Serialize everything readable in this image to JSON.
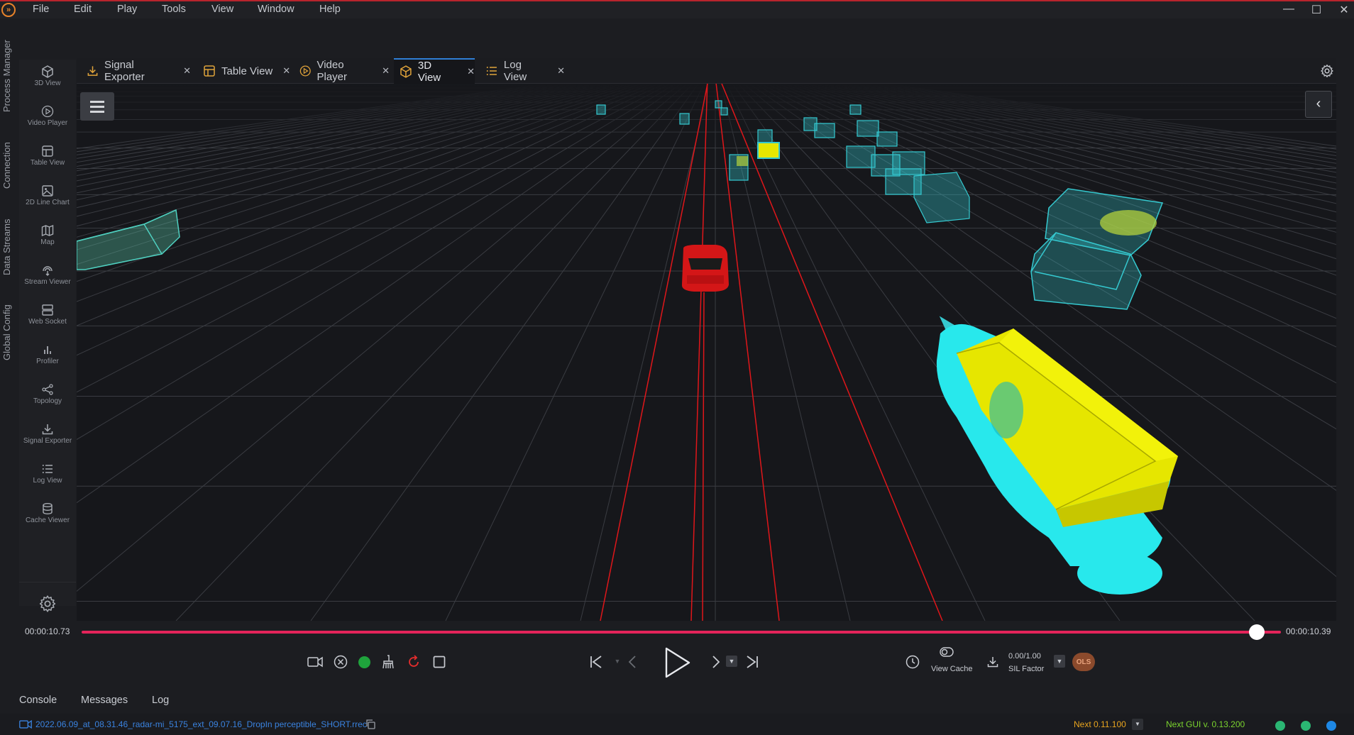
{
  "menu": [
    "File",
    "Edit",
    "Play",
    "Tools",
    "View",
    "Window",
    "Help"
  ],
  "side_tabs": [
    "Process Manager",
    "Connection",
    "Data Streams",
    "Global Config"
  ],
  "nav": [
    {
      "label": "3D View",
      "icon": "cube-icon"
    },
    {
      "label": "Video Player",
      "icon": "play-circle-icon"
    },
    {
      "label": "Table View",
      "icon": "table-icon"
    },
    {
      "label": "2D Line Chart",
      "icon": "image-icon"
    },
    {
      "label": "Map",
      "icon": "map-icon"
    },
    {
      "label": "Stream Viewer",
      "icon": "stream-icon"
    },
    {
      "label": "Web Socket",
      "icon": "server-icon"
    },
    {
      "label": "Profiler",
      "icon": "bar-chart-icon"
    },
    {
      "label": "Topology",
      "icon": "share-icon"
    },
    {
      "label": "Signal Exporter",
      "icon": "download-icon"
    },
    {
      "label": "Log View",
      "icon": "list-icon"
    },
    {
      "label": "Cache Viewer",
      "icon": "database-icon"
    }
  ],
  "tabs": [
    {
      "label": "Signal Exporter",
      "icon": "download-icon",
      "active": false
    },
    {
      "label": "Table View",
      "icon": "table-icon",
      "active": false
    },
    {
      "label": "Video Player",
      "icon": "play-circle-icon",
      "active": false
    },
    {
      "label": "3D View",
      "icon": "cube-icon",
      "active": true
    },
    {
      "label": "Log View",
      "icon": "list-icon",
      "active": false
    }
  ],
  "timeline": {
    "current": "00:00:10.73",
    "total": "00:00:10.39",
    "progress": 0.98
  },
  "controls": {
    "view_cache": "View Cache",
    "sil_value": "0.00/1.00",
    "sil_label": "SIL Factor",
    "ols_badge": "OLS"
  },
  "console_tabs": [
    "Console",
    "Messages",
    "Log"
  ],
  "status": {
    "file": "2022.06.09_at_08.31.46_radar-mi_5175_ext_09.07.16_DropIn perceptible_SHORT.rrec",
    "next_version": "Next 0.11.100",
    "gui_version": "Next GUI v. 0.13.200"
  },
  "colors": {
    "accent": "#2f7fd6",
    "timeline": "#e4245a",
    "lane": "#e0161a",
    "box": "#35c9d0",
    "truck": "#e6e600",
    "status_ok": "#2bb673"
  }
}
